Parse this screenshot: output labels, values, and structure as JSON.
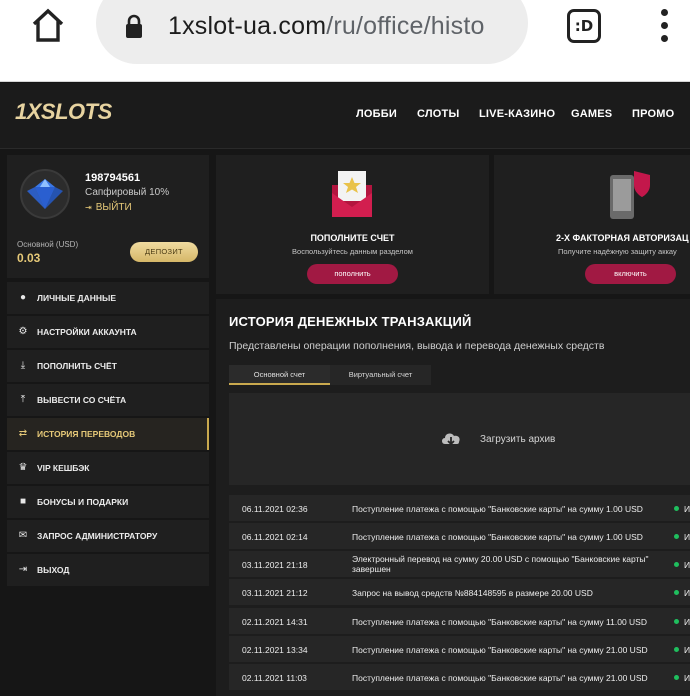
{
  "browser": {
    "url_main": "1xslot-ua.com",
    "url_path": "/ru/office/histo",
    "ext_label": ":D"
  },
  "header": {
    "logo": "1XSLOTS",
    "nav": [
      "ЛОББИ",
      "СЛОТЫ",
      "LIVE-КАЗИНО",
      "GAMES",
      "ПРОМО"
    ]
  },
  "profile": {
    "user_id": "198794561",
    "status": "Сапфировый 10%",
    "logout": "ВЫЙТИ",
    "balance_label": "Основной (USD)",
    "balance_value": "0.03",
    "deposit_button": "ДЕПОЗИТ"
  },
  "sidebar": {
    "items": [
      {
        "label": "ЛИЧНЫЕ ДАННЫЕ",
        "icon": "user-icon"
      },
      {
        "label": "НАСТРОЙКИ АККАУНТА",
        "icon": "settings-icon"
      },
      {
        "label": "ПОПОЛНИТЬ СЧЁТ",
        "icon": "download-icon"
      },
      {
        "label": "ВЫВЕСТИ СО СЧЁТА",
        "icon": "upload-icon"
      },
      {
        "label": "ИСТОРИЯ ПЕРЕВОДОВ",
        "icon": "transfer-icon",
        "active": true
      },
      {
        "label": "VIP КЕШБЭК",
        "icon": "crown-icon"
      },
      {
        "label": "БОНУСЫ И ПОДАРКИ",
        "icon": "gift-icon"
      },
      {
        "label": "ЗАПРОС АДМИНИСТРАТОРУ",
        "icon": "mail-icon"
      },
      {
        "label": "ВЫХОД",
        "icon": "logout-icon"
      }
    ]
  },
  "promo_cards": [
    {
      "title": "ПОПОЛНИТЕ СЧЕТ",
      "subtitle": "Воспользуйтесь данным разделом",
      "button": "пополнить",
      "icon": "envelope-star-icon"
    },
    {
      "title": "2-Х ФАКТОРНАЯ АВТОРИЗАЦ",
      "subtitle": "Получите надёжную защиту аккау",
      "button": "включить",
      "icon": "phone-shield-icon"
    }
  ],
  "history": {
    "title": "ИСТОРИЯ ДЕНЕЖНЫХ ТРАНЗАКЦИЙ",
    "subtitle": "Представлены операции пополнения, вывода и перевода денежных средств",
    "tabs": [
      "Основной счет",
      "Виртуальный счет"
    ],
    "archive_label": "Загрузить архив",
    "rows": [
      {
        "date": "06.11.2021 02:36",
        "desc": "Поступление платежа с помощью \"Банковские карты\" на сумму 1.00 USD",
        "status": "И"
      },
      {
        "date": "06.11.2021 02:14",
        "desc": "Поступление платежа с помощью \"Банковские карты\" на сумму 1.00 USD",
        "status": "И"
      },
      {
        "date": "03.11.2021 21:18",
        "desc": "Электронный перевод на сумму 20.00 USD с помощью \"Банковские карты\" завершен",
        "status": "И"
      },
      {
        "date": "03.11.2021 21:12",
        "desc": "Запрос на вывод средств №884148595 в размере 20.00 USD",
        "status": "И"
      },
      {
        "date": "02.11.2021 14:31",
        "desc": "Поступление платежа с помощью \"Банковские карты\" на сумму 11.00 USD",
        "status": "И"
      },
      {
        "date": "02.11.2021 13:34",
        "desc": "Поступление платежа с помощью \"Банковские карты\" на сумму 21.00 USD",
        "status": "И"
      },
      {
        "date": "02.11.2021 11:03",
        "desc": "Поступление платежа с помощью \"Банковские карты\" на сумму 21.00 USD",
        "status": "И"
      }
    ]
  },
  "colors": {
    "accent_gold": "#e6c978",
    "button_crimson": "#a11943",
    "status_green": "#1fbf5e",
    "background": "#161616"
  }
}
